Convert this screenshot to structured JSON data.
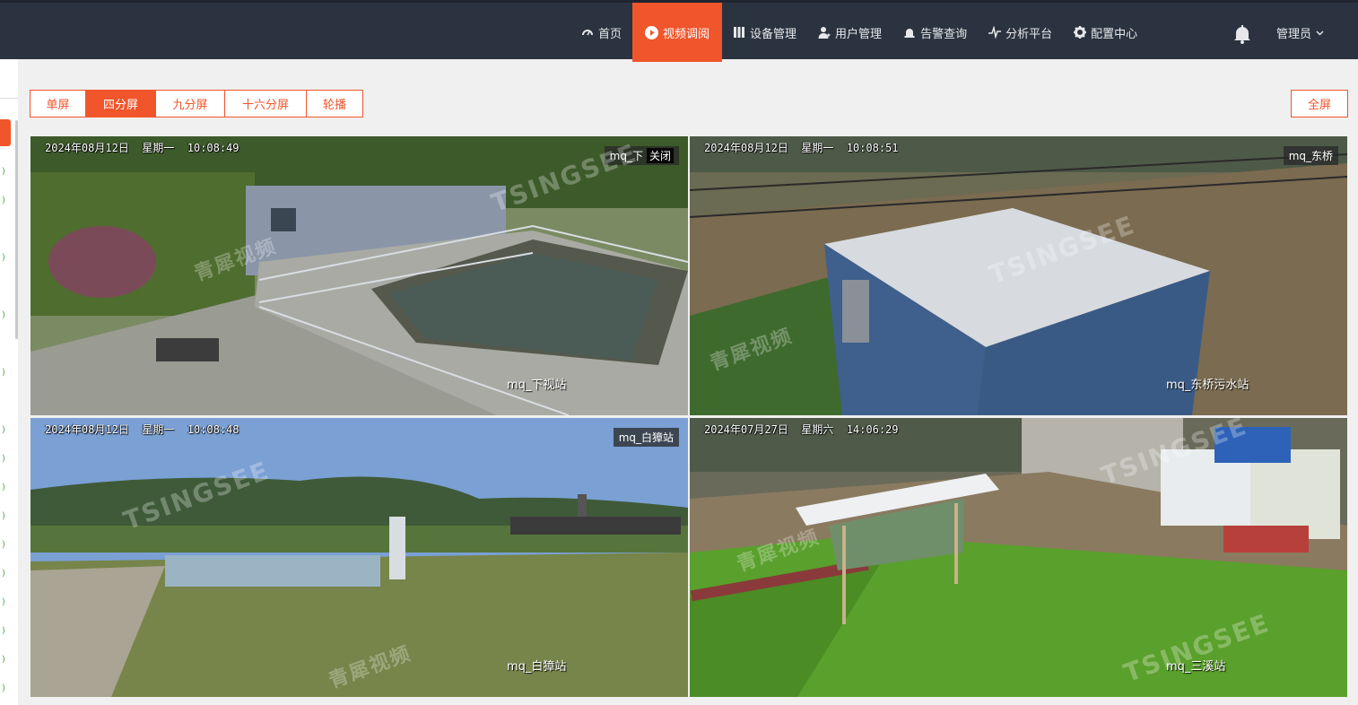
{
  "nav": {
    "items": [
      {
        "label": "首页",
        "icon": "dashboard-icon"
      },
      {
        "label": "视频调阅",
        "icon": "play-circle-icon",
        "active": true
      },
      {
        "label": "设备管理",
        "icon": "device-icon"
      },
      {
        "label": "用户管理",
        "icon": "user-icon"
      },
      {
        "label": "告警查询",
        "icon": "alarm-icon"
      },
      {
        "label": "分析平台",
        "icon": "pulse-icon"
      },
      {
        "label": "配置中心",
        "icon": "gear-icon"
      }
    ],
    "user": "管理员",
    "accent": "#f0552b",
    "bg": "#2b3340"
  },
  "splits": {
    "options": [
      "单屏",
      "四分屏",
      "九分屏",
      "十六分屏",
      "轮播"
    ],
    "active": "四分屏",
    "fullscreen_label": "全屏"
  },
  "watermark": {
    "brand": "TSINGSEE",
    "cn": "青犀视频"
  },
  "cameras": [
    {
      "timestamp": "2024年08月12日  星期一  10:08:49",
      "tag": "mq_下",
      "close_label": "关闭",
      "name": "mq_下视站"
    },
    {
      "timestamp": "2024年08月12日  星期一  10:08:51",
      "tag": "mq_东桥",
      "name": "mq_东桥污水站"
    },
    {
      "timestamp": "2024年08月12日  星期一  10:08:48",
      "tag": "mq_白獐站",
      "name": "mq_白獐站"
    },
    {
      "timestamp": "2024年07月27日  星期六  14:06:29",
      "name": "mq_三溪站"
    }
  ]
}
